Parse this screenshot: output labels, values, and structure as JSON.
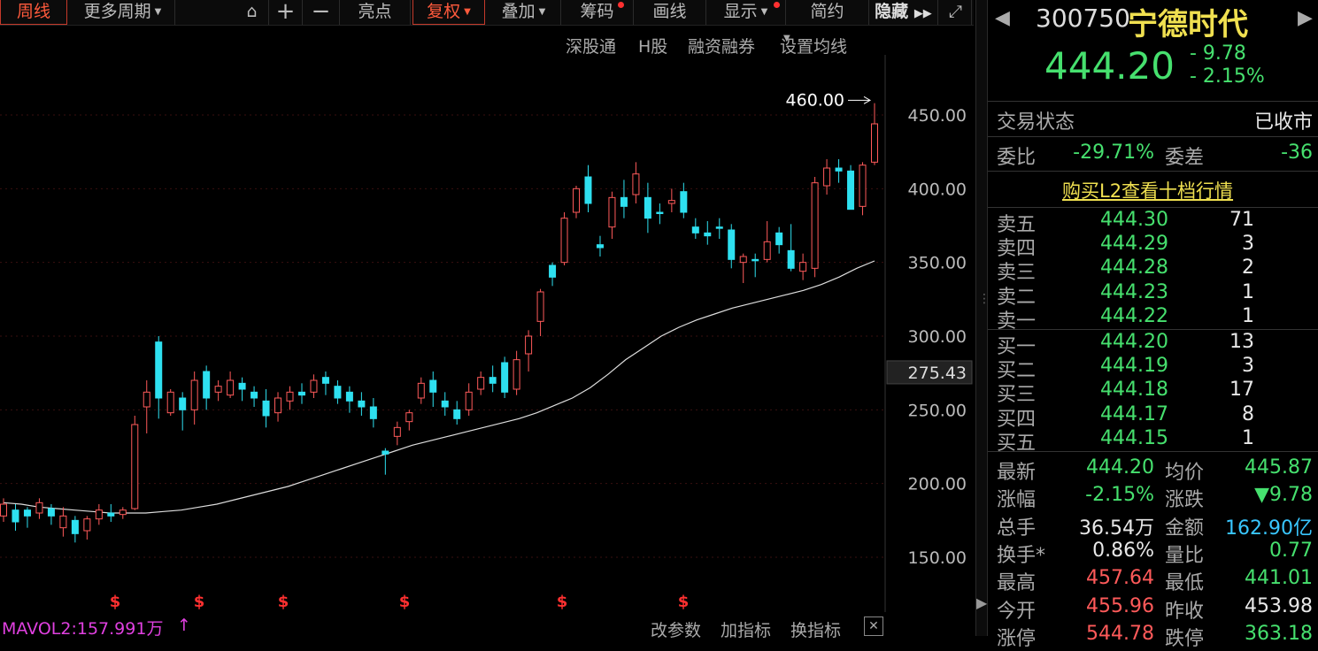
{
  "toolbar": {
    "period": "周线",
    "more_period": "更多周期",
    "highlight": "亮点",
    "rights": "复权",
    "overlay": "叠加",
    "chips": "筹码",
    "draw": "画线",
    "display": "显示",
    "simple": "简约",
    "hide": "隐藏"
  },
  "sub_links": [
    "深股通",
    "H股",
    "融资融券",
    "设置均线"
  ],
  "chart": {
    "y_ticks": [
      "450.00",
      "400.00",
      "350.00",
      "300.00",
      "250.00",
      "200.00",
      "150.00"
    ],
    "current_ma_label": "275.43",
    "peak_label": "460.00",
    "signal_marker": "$"
  },
  "bottom": {
    "indicator": "MAVOL2:157.991万",
    "change_params": "改参数",
    "add_indicator": "加指标",
    "swap_indicator": "换指标"
  },
  "stock": {
    "code": "300750",
    "name": "宁德时代",
    "price": "444.20",
    "change": "- 9.78",
    "change_pct": "- 2.15%"
  },
  "status": {
    "label": "交易状态",
    "value": "已收市"
  },
  "commission": {
    "ratio_label": "委比",
    "ratio": "-29.71%",
    "diff_label": "委差",
    "diff": "-36"
  },
  "l2_link": "购买L2查看十档行情",
  "asks": [
    {
      "label": "卖五",
      "price": "444.30",
      "vol": "71"
    },
    {
      "label": "卖四",
      "price": "444.29",
      "vol": "3"
    },
    {
      "label": "卖三",
      "price": "444.28",
      "vol": "2"
    },
    {
      "label": "卖二",
      "price": "444.23",
      "vol": "1"
    },
    {
      "label": "卖一",
      "price": "444.22",
      "vol": "1"
    }
  ],
  "bids": [
    {
      "label": "买一",
      "price": "444.20",
      "vol": "13"
    },
    {
      "label": "买二",
      "price": "444.19",
      "vol": "3"
    },
    {
      "label": "买三",
      "price": "444.18",
      "vol": "17"
    },
    {
      "label": "买四",
      "price": "444.17",
      "vol": "8"
    },
    {
      "label": "买五",
      "price": "444.15",
      "vol": "1"
    }
  ],
  "stats": [
    {
      "l1": "最新",
      "v1": "444.20",
      "c1": "green",
      "l2": "均价",
      "v2": "445.87",
      "c2": "green"
    },
    {
      "l1": "涨幅",
      "v1": "-2.15%",
      "c1": "green",
      "l2": "涨跌",
      "v2": "▼9.78",
      "c2": "green"
    },
    {
      "l1": "总手",
      "v1": "36.54万",
      "c1": "white",
      "l2": "金额",
      "v2": "162.90亿",
      "c2": "cyan"
    },
    {
      "l1": "换手*",
      "v1": "0.86%",
      "c1": "white",
      "l2": "量比",
      "v2": "0.77",
      "c2": "green"
    },
    {
      "l1": "最高",
      "v1": "457.64",
      "c1": "red",
      "l2": "最低",
      "v2": "441.01",
      "c2": "green"
    },
    {
      "l1": "今开",
      "v1": "455.96",
      "c1": "red",
      "l2": "昨收",
      "v2": "453.98",
      "c2": "white"
    },
    {
      "l1": "涨停",
      "v1": "544.78",
      "c1": "red",
      "l2": "跌停",
      "v2": "363.18",
      "c2": "green"
    }
  ],
  "chart_data": {
    "type": "candlestick",
    "y_range": [
      125,
      475
    ],
    "ma_line": [
      187,
      186,
      184,
      183,
      182,
      181,
      180,
      180,
      180,
      181,
      182,
      184,
      186,
      189,
      192,
      195,
      198,
      202,
      206,
      210,
      214,
      218,
      222,
      226,
      229,
      232,
      235,
      238,
      241,
      244,
      248,
      253,
      258,
      265,
      274,
      284,
      292,
      300,
      306,
      311,
      315,
      319,
      322,
      325,
      328,
      331,
      335,
      340,
      346,
      351
    ],
    "candles": [
      [
        186,
        178,
        190,
        174,
        "u"
      ],
      [
        174,
        182,
        186,
        168,
        "d"
      ],
      [
        178,
        182,
        184,
        170,
        "d"
      ],
      [
        180,
        187,
        190,
        176,
        "u"
      ],
      [
        183,
        178,
        186,
        172,
        "d"
      ],
      [
        170,
        178,
        184,
        164,
        "u"
      ],
      [
        175,
        166,
        178,
        160,
        "d"
      ],
      [
        168,
        176,
        178,
        162,
        "u"
      ],
      [
        176,
        182,
        186,
        172,
        "u"
      ],
      [
        180,
        178,
        186,
        174,
        "d"
      ],
      [
        179,
        182,
        184,
        176,
        "u"
      ],
      [
        183,
        240,
        246,
        182,
        "u"
      ],
      [
        252,
        262,
        270,
        234,
        "u"
      ],
      [
        296,
        258,
        300,
        244,
        "d"
      ],
      [
        248,
        262,
        264,
        246,
        "u"
      ],
      [
        258,
        250,
        262,
        236,
        "d"
      ],
      [
        250,
        270,
        276,
        240,
        "u"
      ],
      [
        276,
        258,
        280,
        250,
        "d"
      ],
      [
        262,
        266,
        270,
        256,
        "u"
      ],
      [
        260,
        270,
        276,
        258,
        "u"
      ],
      [
        268,
        264,
        272,
        256,
        "d"
      ],
      [
        262,
        258,
        266,
        252,
        "d"
      ],
      [
        256,
        246,
        264,
        238,
        "d"
      ],
      [
        248,
        258,
        262,
        242,
        "u"
      ],
      [
        256,
        262,
        266,
        250,
        "u"
      ],
      [
        262,
        260,
        268,
        254,
        "d"
      ],
      [
        262,
        270,
        274,
        258,
        "u"
      ],
      [
        272,
        268,
        276,
        260,
        "d"
      ],
      [
        266,
        258,
        270,
        254,
        "d"
      ],
      [
        262,
        256,
        266,
        248,
        "d"
      ],
      [
        256,
        252,
        262,
        246,
        "d"
      ],
      [
        252,
        244,
        258,
        238,
        "d"
      ],
      [
        222,
        220,
        224,
        206,
        "d"
      ],
      [
        232,
        238,
        242,
        226,
        "u"
      ],
      [
        242,
        248,
        250,
        236,
        "u"
      ],
      [
        258,
        268,
        272,
        254,
        "u"
      ],
      [
        270,
        262,
        276,
        252,
        "d"
      ],
      [
        256,
        252,
        262,
        246,
        "d"
      ],
      [
        250,
        244,
        256,
        240,
        "d"
      ],
      [
        250,
        262,
        268,
        246,
        "u"
      ],
      [
        264,
        272,
        276,
        260,
        "u"
      ],
      [
        272,
        268,
        280,
        262,
        "d"
      ],
      [
        282,
        262,
        286,
        258,
        "d"
      ],
      [
        264,
        284,
        290,
        260,
        "u"
      ],
      [
        288,
        300,
        304,
        276,
        "u"
      ],
      [
        310,
        330,
        332,
        300,
        "u"
      ],
      [
        340,
        348,
        350,
        334,
        "d"
      ],
      [
        350,
        380,
        384,
        348,
        "u"
      ],
      [
        384,
        400,
        402,
        380,
        "u"
      ],
      [
        408,
        390,
        416,
        384,
        "d"
      ]
    ],
    "candles2": [
      [
        360,
        362,
        368,
        354,
        "d"
      ],
      [
        374,
        394,
        398,
        366,
        "u"
      ],
      [
        394,
        388,
        406,
        380,
        "d"
      ],
      [
        396,
        410,
        418,
        390,
        "u"
      ],
      [
        394,
        380,
        404,
        370,
        "d"
      ],
      [
        384,
        384,
        390,
        376,
        "d"
      ],
      [
        390,
        392,
        400,
        384,
        "u"
      ],
      [
        398,
        384,
        404,
        380,
        "d"
      ],
      [
        374,
        370,
        380,
        366,
        "d"
      ],
      [
        370,
        368,
        378,
        362,
        "d"
      ],
      [
        374,
        374,
        380,
        366,
        "d"
      ],
      [
        372,
        352,
        376,
        346,
        "d"
      ],
      [
        350,
        354,
        356,
        336,
        "u"
      ],
      [
        352,
        352,
        356,
        340,
        "d"
      ],
      [
        352,
        364,
        378,
        350,
        "u"
      ],
      [
        370,
        362,
        374,
        356,
        "d"
      ],
      [
        358,
        346,
        376,
        344,
        "d"
      ],
      [
        350,
        344,
        356,
        338,
        "u"
      ],
      [
        346,
        404,
        408,
        340,
        "u"
      ],
      [
        402,
        414,
        420,
        396,
        "u"
      ],
      [
        414,
        412,
        420,
        404,
        "d"
      ],
      [
        412,
        386,
        416,
        386,
        "d"
      ],
      [
        388,
        416,
        418,
        382,
        "u"
      ],
      [
        418,
        444,
        458,
        416,
        "u"
      ]
    ],
    "peak_value": 460,
    "signal_positions": [
      130,
      225,
      320,
      457,
      635,
      772
    ]
  }
}
